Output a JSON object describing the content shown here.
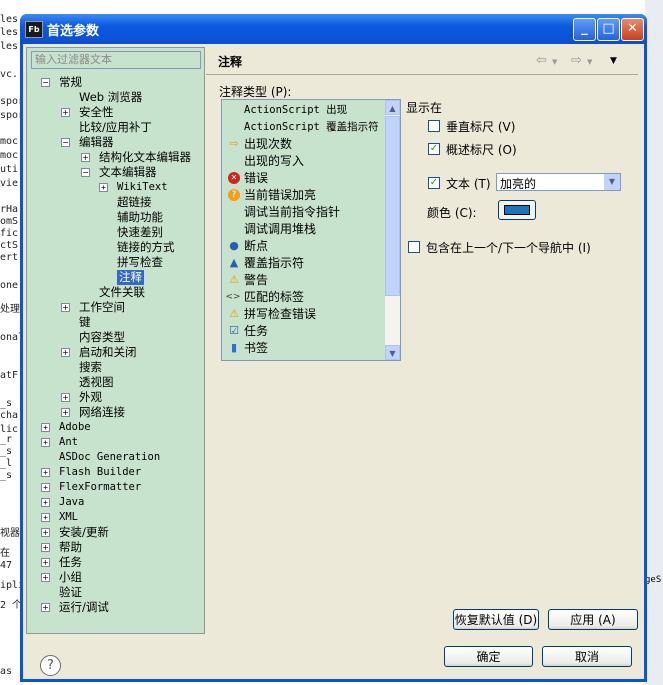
{
  "background": {
    "left_lines": [
      "les",
      "les",
      "les",
      "vc.",
      "spor",
      "spor",
      "moc",
      "moc",
      "uti",
      "vie",
      "rHa",
      "omS",
      "fic",
      "ctS",
      "ert",
      "one",
      "处理",
      "onal",
      "atF",
      "_s",
      "cha",
      "lic",
      "_r",
      "_s",
      "_l",
      "_s",
      "视器",
      "在",
      "47",
      "ipli",
      "2 个",
      "as"
    ],
    "right_fragment": "geS"
  },
  "window": {
    "icon_text": "Fb",
    "title": "首选参数",
    "controls": {
      "minimize": "_",
      "maximize": "□",
      "close": "✕"
    }
  },
  "filter": {
    "placeholder": "输入过滤器文本"
  },
  "tree": [
    {
      "label": "常规",
      "level": 0,
      "expander": "−"
    },
    {
      "label": "Web 浏览器",
      "level": 1,
      "expander": ""
    },
    {
      "label": "安全性",
      "level": 1,
      "expander": "+"
    },
    {
      "label": "比较/应用补丁",
      "level": 1,
      "expander": ""
    },
    {
      "label": "编辑器",
      "level": 1,
      "expander": "−"
    },
    {
      "label": "结构化文本编辑器",
      "level": 2,
      "expander": "+"
    },
    {
      "label": "文本编辑器",
      "level": 2,
      "expander": "−"
    },
    {
      "label": "WikiText",
      "level": 3,
      "expander": "+",
      "mono": true
    },
    {
      "label": "超链接",
      "level": 3,
      "expander": ""
    },
    {
      "label": "辅助功能",
      "level": 3,
      "expander": ""
    },
    {
      "label": "快速差别",
      "level": 3,
      "expander": ""
    },
    {
      "label": "链接的方式",
      "level": 3,
      "expander": ""
    },
    {
      "label": "拼写检查",
      "level": 3,
      "expander": ""
    },
    {
      "label": "注释",
      "level": 3,
      "expander": "",
      "selected": true
    },
    {
      "label": "文件关联",
      "level": 2,
      "expander": ""
    },
    {
      "label": "工作空间",
      "level": 1,
      "expander": "+"
    },
    {
      "label": "键",
      "level": 1,
      "expander": ""
    },
    {
      "label": "内容类型",
      "level": 1,
      "expander": ""
    },
    {
      "label": "启动和关闭",
      "level": 1,
      "expander": "+"
    },
    {
      "label": "搜索",
      "level": 1,
      "expander": ""
    },
    {
      "label": "透视图",
      "level": 1,
      "expander": ""
    },
    {
      "label": "外观",
      "level": 1,
      "expander": "+"
    },
    {
      "label": "网络连接",
      "level": 1,
      "expander": "+"
    },
    {
      "label": "Adobe",
      "level": 0,
      "expander": "+",
      "mono": true
    },
    {
      "label": "Ant",
      "level": 0,
      "expander": "+",
      "mono": true
    },
    {
      "label": "ASDoc Generation",
      "level": 0,
      "expander": "",
      "mono": true
    },
    {
      "label": "Flash Builder",
      "level": 0,
      "expander": "+",
      "mono": true
    },
    {
      "label": "FlexFormatter",
      "level": 0,
      "expander": "+",
      "mono": true
    },
    {
      "label": "Java",
      "level": 0,
      "expander": "+",
      "mono": true
    },
    {
      "label": "XML",
      "level": 0,
      "expander": "+",
      "mono": true
    },
    {
      "label": "安装/更新",
      "level": 0,
      "expander": "+"
    },
    {
      "label": "帮助",
      "level": 0,
      "expander": "+"
    },
    {
      "label": "任务",
      "level": 0,
      "expander": "+"
    },
    {
      "label": "小组",
      "level": 0,
      "expander": "+"
    },
    {
      "label": "验证",
      "level": 0,
      "expander": ""
    },
    {
      "label": "运行/调试",
      "level": 0,
      "expander": "+"
    }
  ],
  "header": {
    "title": "注释",
    "back": "⇦",
    "forward": "⇨",
    "menu": "▼"
  },
  "annotation_types": {
    "label": "注释类型 (P):",
    "items": [
      {
        "label": "ActionScript 出现",
        "icon": "",
        "icon_name": "none",
        "color": "#000000",
        "mono": true
      },
      {
        "label": "ActionScript 覆盖指示符",
        "icon": "",
        "icon_name": "none",
        "color": "#000000",
        "mono": true
      },
      {
        "label": "出现次数",
        "icon": "⇨",
        "icon_name": "arrow-right-icon",
        "color": "#e0a020"
      },
      {
        "label": "出现的写入",
        "icon": "",
        "icon_name": "none",
        "color": "#000000"
      },
      {
        "label": "错误",
        "icon": "✕",
        "icon_name": "error-icon",
        "color": "#d0241c"
      },
      {
        "label": "当前错误加亮",
        "icon": "?",
        "icon_name": "question-icon",
        "color": "#f0a010"
      },
      {
        "label": "调试当前指令指针",
        "icon": "",
        "icon_name": "none",
        "color": "#000000"
      },
      {
        "label": "调试调用堆栈",
        "icon": "",
        "icon_name": "none",
        "color": "#000000"
      },
      {
        "label": "断点",
        "icon": "●",
        "icon_name": "breakpoint-icon",
        "color": "#2c5fa8"
      },
      {
        "label": "覆盖指示符",
        "icon": "▲",
        "icon_name": "override-icon",
        "color": "#2c5fa8"
      },
      {
        "label": "警告",
        "icon": "⚠",
        "icon_name": "warning-icon",
        "color": "#e0a000"
      },
      {
        "label": "匹配的标签",
        "icon": "<>",
        "icon_name": "tag-icon",
        "color": "#444444"
      },
      {
        "label": "拼写检查错误",
        "icon": "⚠",
        "icon_name": "warning-icon",
        "color": "#e0a000"
      },
      {
        "label": "任务",
        "icon": "☑",
        "icon_name": "task-icon",
        "color": "#2c5fa8"
      },
      {
        "label": "书签",
        "icon": "▮",
        "icon_name": "bookmark-icon",
        "color": "#2c6fd8"
      }
    ]
  },
  "show_in": {
    "label": "显示在",
    "vertical_ruler": {
      "label": "垂直标尺 (V)",
      "checked": false
    },
    "overview_ruler": {
      "label": "概述标尺 (O)",
      "checked": true
    },
    "text": {
      "label": "文本 (T)",
      "checked": true
    },
    "text_style": "加亮的",
    "color_label": "颜色 (C):",
    "color_value": "#1b75bc"
  },
  "include_nav": {
    "label": "包含在上一个/下一个导航中 (I)",
    "checked": false
  },
  "buttons": {
    "restore_defaults": "恢复默认值 (D)",
    "apply": "应用 (A)",
    "ok": "确定",
    "cancel": "取消",
    "help": "?"
  }
}
